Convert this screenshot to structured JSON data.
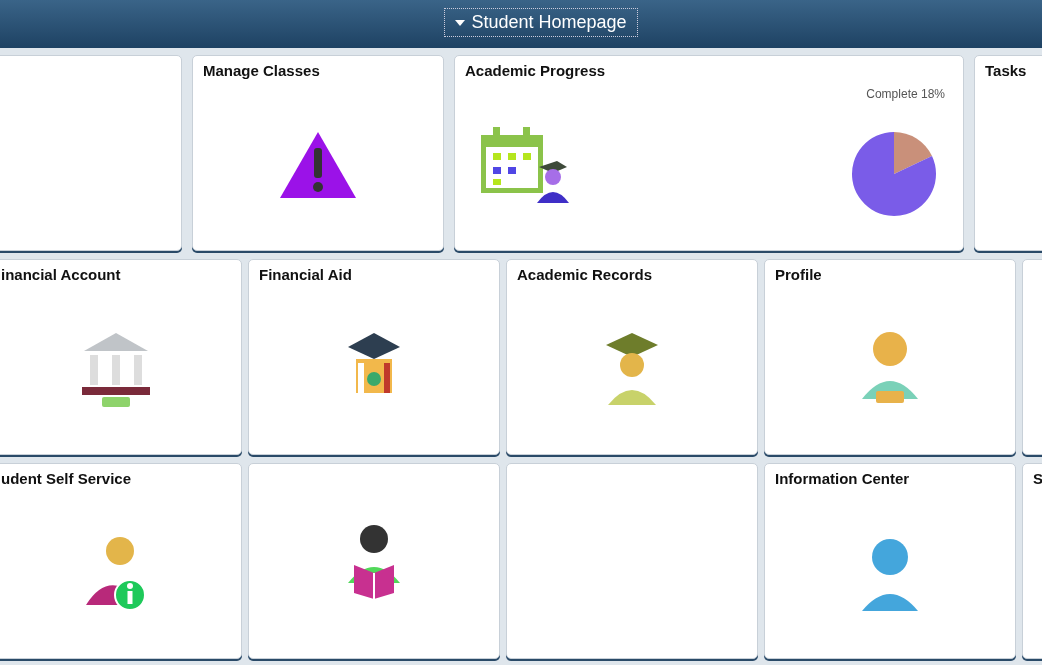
{
  "header": {
    "title": "Student Homepage"
  },
  "rows": [
    {
      "tiles": [
        {
          "kind": "blank"
        },
        {
          "kind": "icon",
          "title": "Manage Classes"
        },
        {
          "kind": "chart",
          "title": "Academic Progress",
          "wide": true,
          "chart_data": {
            "type": "pie",
            "values": [
              18,
              82
            ]
          },
          "chart_label": "Complete 18%"
        },
        {
          "kind": "blank",
          "title": "Tasks"
        }
      ]
    },
    {
      "tiles": [
        {
          "kind": "icon",
          "title": "inancial Account"
        },
        {
          "kind": "icon",
          "title": "Financial Aid"
        },
        {
          "kind": "icon",
          "title": "Academic Records"
        },
        {
          "kind": "icon",
          "title": "Profile"
        },
        {
          "kind": "blank"
        }
      ]
    },
    {
      "tiles": [
        {
          "kind": "icon",
          "title": "udent Self Service"
        },
        {
          "kind": "icon"
        },
        {
          "kind": "blank"
        },
        {
          "kind": "icon",
          "title": "Information Center"
        },
        {
          "kind": "blank",
          "title": "S"
        }
      ]
    }
  ]
}
